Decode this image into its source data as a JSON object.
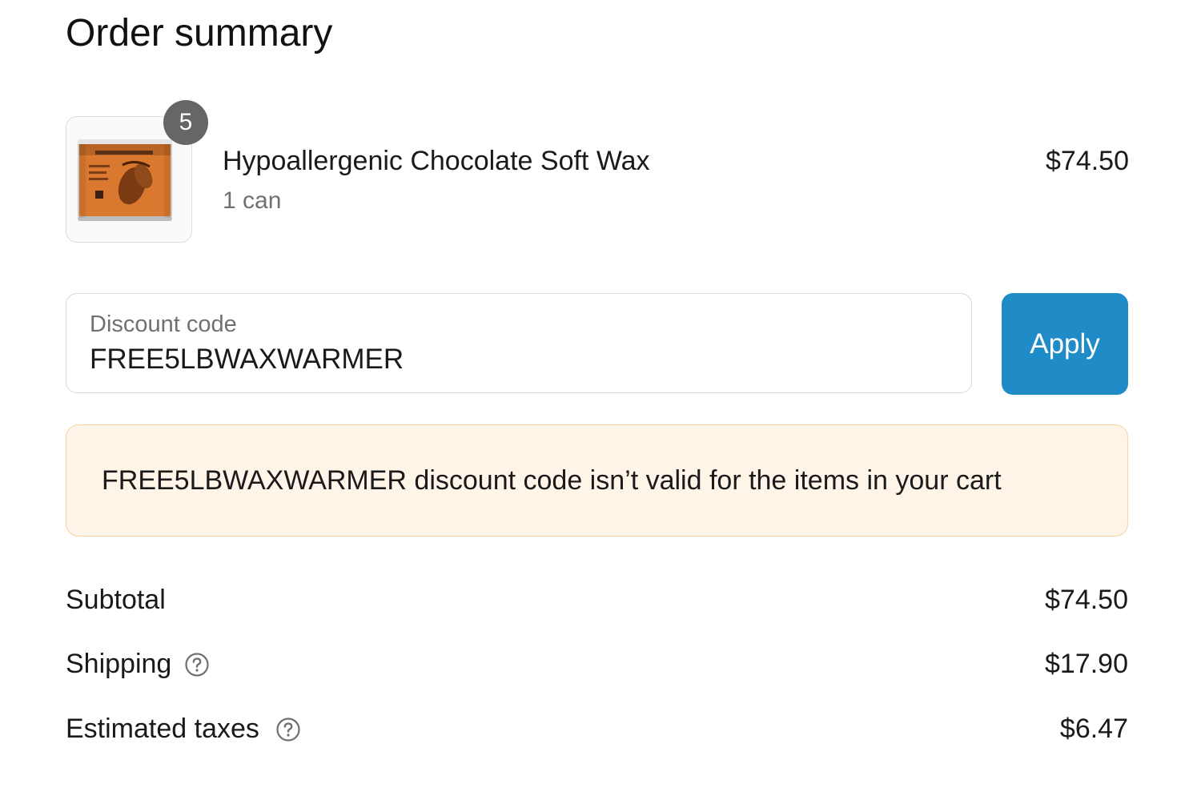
{
  "summary": {
    "title": "Order summary"
  },
  "line_item": {
    "quantity_badge": "5",
    "name": "Hypoallergenic Chocolate Soft Wax",
    "variant": "1 can",
    "price": "$74.50"
  },
  "discount": {
    "label": "Discount code",
    "value": "FREE5LBWAXWARMER",
    "apply_label": "Apply",
    "error_message": "FREE5LBWAXWARMER discount code isn’t valid for the items in your cart"
  },
  "totals": {
    "subtotal_label": "Subtotal",
    "subtotal_value": "$74.50",
    "shipping_label": "Shipping",
    "shipping_value": "$17.90",
    "taxes_label": "Estimated taxes",
    "taxes_value": "$6.47"
  },
  "colors": {
    "apply_button": "#1f8bc7",
    "alert_background": "#fff4e8",
    "alert_border": "#f8d3a7",
    "badge": "#666666"
  },
  "icons": {
    "shipping_help": "question-circle-icon",
    "taxes_help": "question-circle-icon",
    "product_image": "chocolate-wax-can-image"
  }
}
